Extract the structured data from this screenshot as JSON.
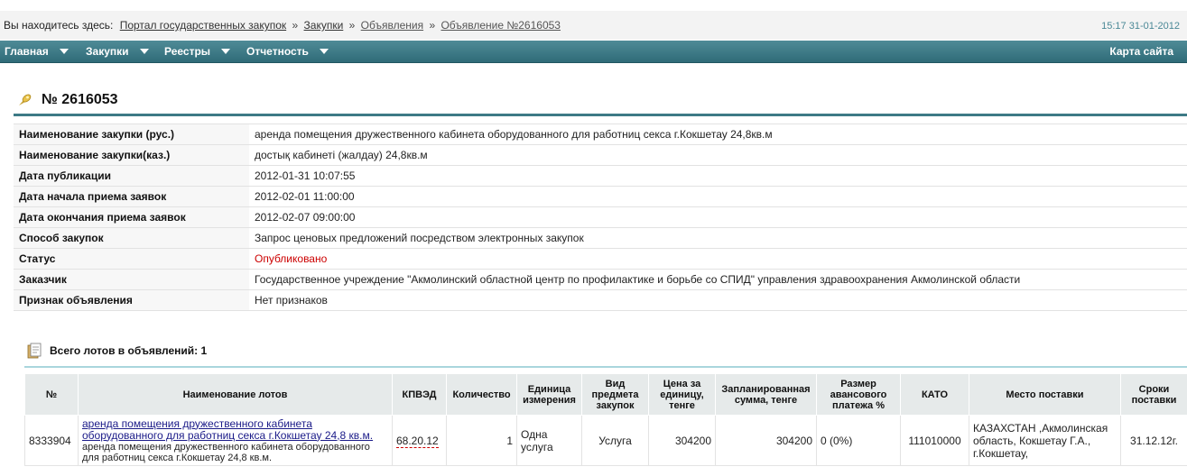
{
  "breadcrumb": {
    "prefix": "Вы находитесь здесь:",
    "items": [
      "Портал государственных закупок",
      "Закупки",
      "Объявления",
      "Объявление №2616053"
    ],
    "separator": "»"
  },
  "clock": "15:17 31-01-2012",
  "nav": {
    "items": [
      "Главная",
      "Закупки",
      "Реестры",
      "Отчетность"
    ],
    "sitemap": "Карта сайта"
  },
  "page_title": "№ 2616053",
  "details": [
    {
      "label": "Наименование закупки (рус.)",
      "value": "аренда помещения дружественного кабинета оборудованного для работниц секса г.Кокшетау 24,8кв.м"
    },
    {
      "label": "Наименование закупки(каз.)",
      "value": "достық кабинеті (жалдау) 24,8кв.м"
    },
    {
      "label": "Дата публикации",
      "value": "2012-01-31 10:07:55"
    },
    {
      "label": "Дата начала приема заявок",
      "value": "2012-02-01 11:00:00"
    },
    {
      "label": "Дата окончания приема заявок",
      "value": "2012-02-07 09:00:00"
    },
    {
      "label": "Способ закупок",
      "value": "Запрос ценовых предложений посредством электронных закупок"
    },
    {
      "label": "Статус",
      "value": "Опубликовано"
    },
    {
      "label": "Заказчик",
      "value": "Государственное учреждение \"Акмолинский областной центр по профилактике и борьбе со СПИД\" управления здравоохранения Акмолинской области"
    },
    {
      "label": "Признак объявления",
      "value": "Нет признаков"
    }
  ],
  "status_color": "#cc0000",
  "lots_summary": "Всего лотов в объявлений: 1",
  "lots_table": {
    "headers": [
      "№",
      "Наименование лотов",
      "КПВЭД",
      "Количество",
      "Единица измерения",
      "Вид предмета закупок",
      "Цена за единицу, тенге",
      "Запланированная сумма, тенге",
      "Размер авансового платежа %",
      "КАТО",
      "Место поставки",
      "Сроки поставки"
    ],
    "rows": [
      {
        "number": "8333904",
        "name_link": "аренда помещения дружественного кабинета оборудованного для работниц секса г.Кокшетау 24,8 кв.м.",
        "name_sub": "аренда помещения дружественного кабинета оборудованного для работниц секса г.Кокшетау 24,8 кв.м.",
        "kpved": "68.20.12",
        "quantity": "1",
        "unit": "Одна услуга",
        "type": "Услуга",
        "unit_price": "304200",
        "planned_sum": "304200",
        "advance": "0 (0%)",
        "kato": "111010000",
        "place": "КАЗАХСТАН ,Акмолинская область, Кокшетау Г.А., г.Кокшетау,",
        "term": "31.12.12г."
      }
    ]
  }
}
